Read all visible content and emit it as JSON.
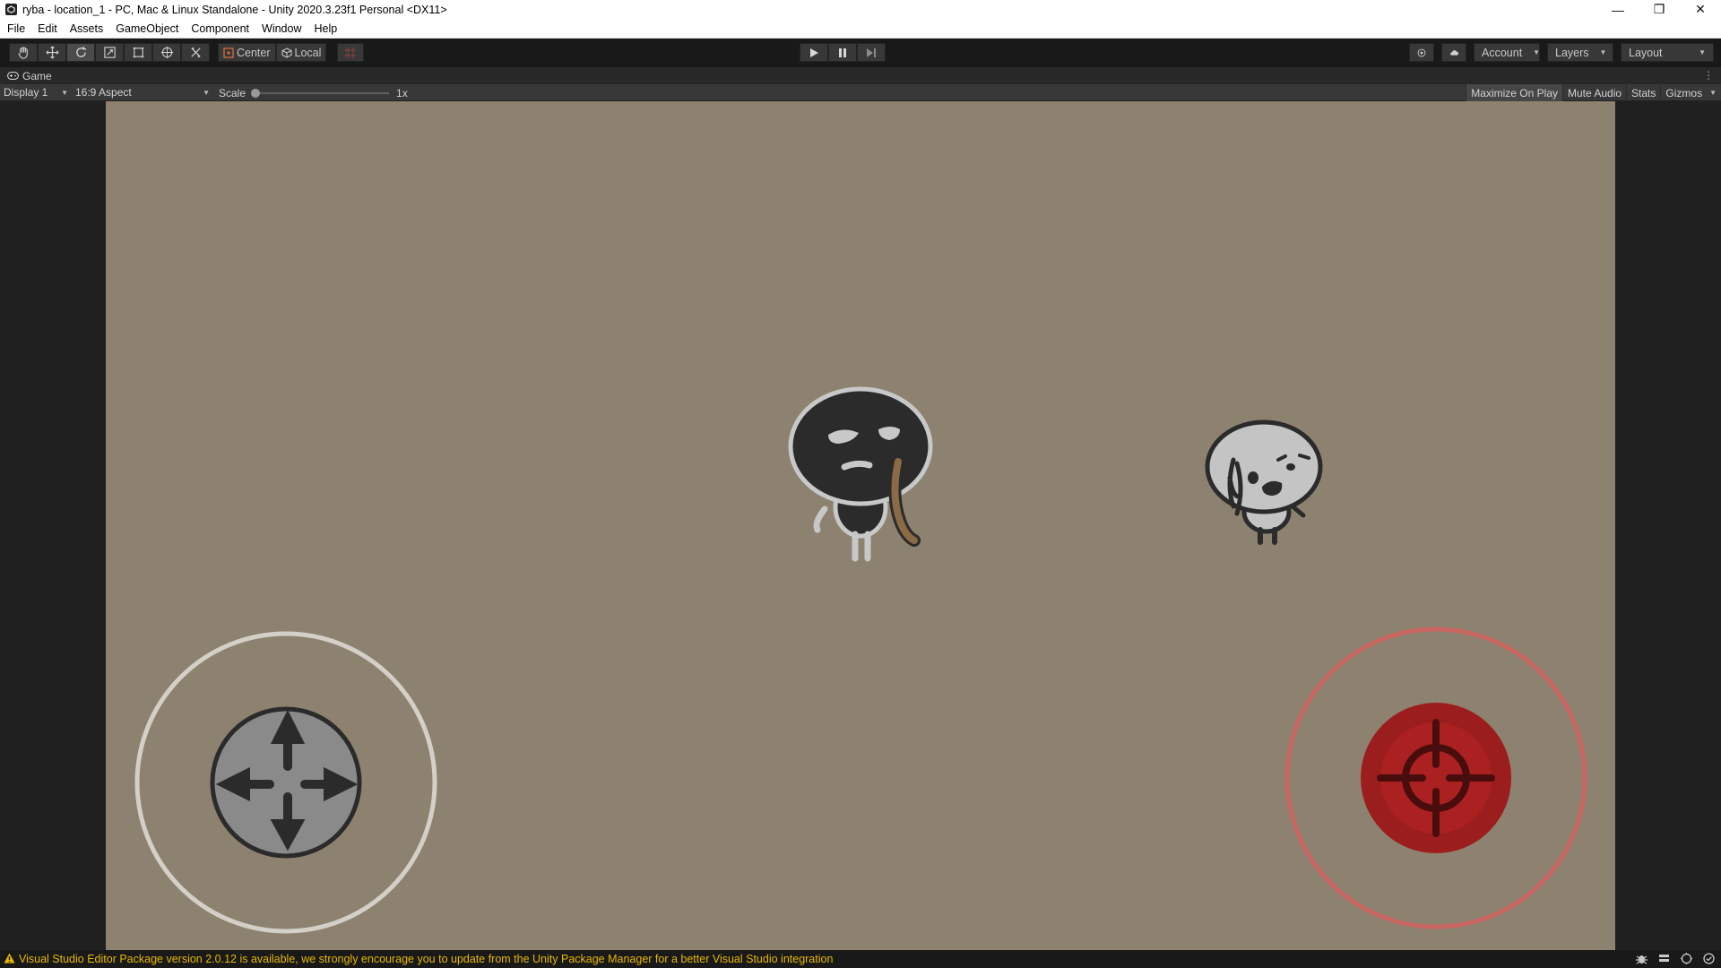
{
  "window": {
    "title": "ryba - location_1 - PC, Mac & Linux Standalone - Unity 2020.3.23f1 Personal <DX11>",
    "minimize_glyph": "—",
    "maximize_glyph": "❐",
    "close_glyph": "✕"
  },
  "menu": [
    "File",
    "Edit",
    "Assets",
    "GameObject",
    "Component",
    "Window",
    "Help"
  ],
  "toolbar": {
    "tools": [
      {
        "name": "hand-tool",
        "icon": "hand-icon"
      },
      {
        "name": "move-tool",
        "icon": "move-arrows-icon"
      },
      {
        "name": "rotate-tool",
        "icon": "rotate-icon",
        "active": true
      },
      {
        "name": "scale-tool",
        "icon": "scale-icon"
      },
      {
        "name": "rect-tool",
        "icon": "rect-icon"
      },
      {
        "name": "transform-tool",
        "icon": "transform-icon"
      },
      {
        "name": "custom-tool",
        "icon": "tools-icon"
      }
    ],
    "pivot_label": "Center",
    "rotation_label": "Local",
    "account_label": "Account",
    "layers_label": "Layers",
    "layout_label": "Layout"
  },
  "game_panel": {
    "tab_label": "Game",
    "display_label": "Display 1",
    "aspect_label": "16:9 Aspect",
    "scale_label": "Scale",
    "scale_value": "1x",
    "scale_fraction": 0.0,
    "toggles": {
      "maximize": "Maximize On Play",
      "mute": "Mute Audio",
      "stats": "Stats",
      "gizmos": "Gizmos"
    }
  },
  "scene": {
    "background_color": "#8c826f",
    "player": {
      "body_color": "#2b2b2b",
      "outline_color": "#c8c8c8",
      "weapon_color": "#8b6a46"
    },
    "enemy": {
      "body_color": "#c4c4c4",
      "outline_color": "#2b2b2b"
    },
    "move_joystick": {
      "ring_color": "#d4d0c8",
      "knob_color": "#8a8a8a",
      "icon": "four-arrows-icon"
    },
    "aim_joystick": {
      "ring_color": "#c96662",
      "knob_color": "#9c1d1d",
      "icon": "crosshair-icon"
    }
  },
  "status": {
    "message": "Visual Studio Editor Package version 2.0.12 is available, we strongly encourage you to update from the Unity Package Manager for a better Visual Studio integration",
    "color": "#e6b800"
  }
}
